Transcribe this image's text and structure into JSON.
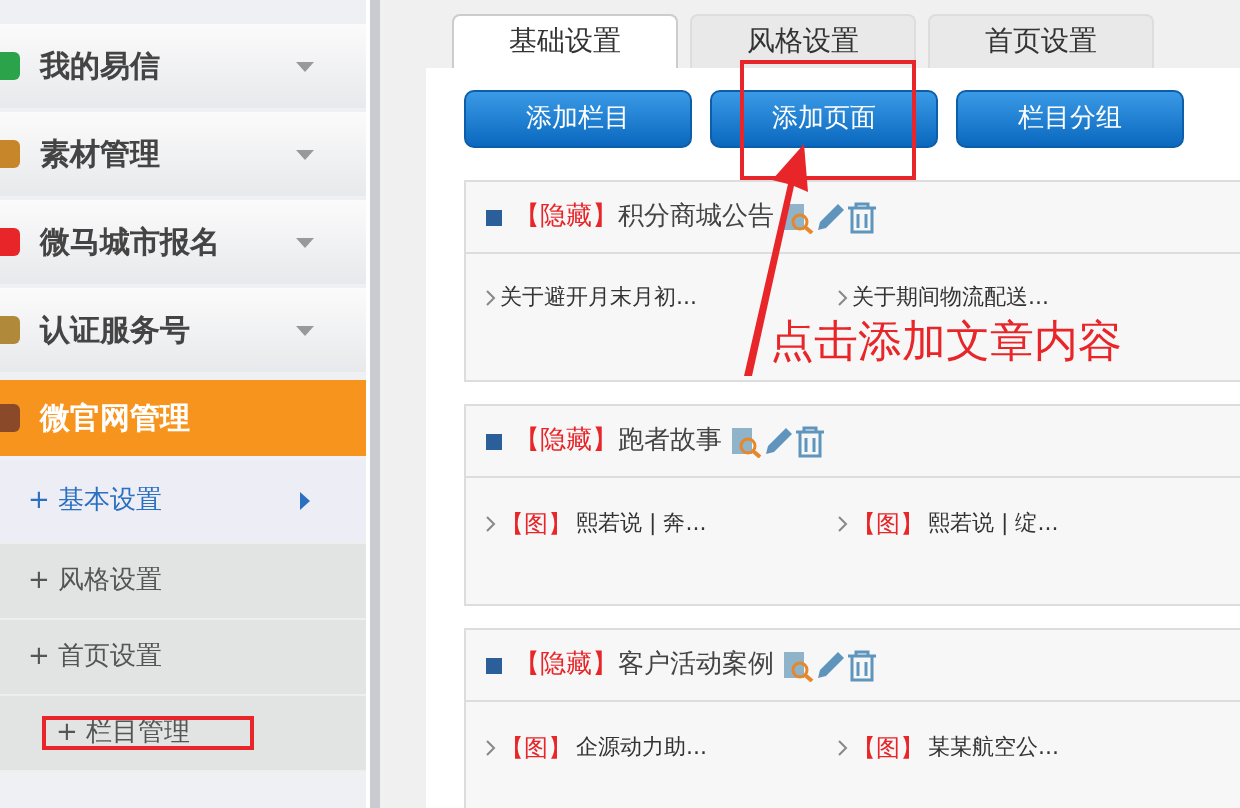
{
  "sidebar": {
    "items": [
      {
        "label": "我的易信",
        "expanded": false
      },
      {
        "label": "素材管理",
        "expanded": false
      },
      {
        "label": "微马城市报名",
        "expanded": false
      },
      {
        "label": "认证服务号",
        "expanded": false
      },
      {
        "label": "微官网管理",
        "expanded": true,
        "children": [
          {
            "label": "+ 基本设置",
            "selected": true
          },
          {
            "label": "+ 风格设置",
            "selected": false
          },
          {
            "label": "+ 首页设置",
            "selected": false
          },
          {
            "label": "+ 栏目管理",
            "selected": false,
            "highlighted": true
          }
        ]
      }
    ]
  },
  "tabs": [
    {
      "label": "基础设置",
      "selected": true
    },
    {
      "label": "风格设置",
      "selected": false
    },
    {
      "label": "首页设置",
      "selected": false
    }
  ],
  "buttons": [
    {
      "label": "添加栏目",
      "highlighted": false
    },
    {
      "label": "添加页面",
      "highlighted": true
    },
    {
      "label": "栏目分组",
      "highlighted": false
    }
  ],
  "annotation": {
    "text": "点击添加文章内容"
  },
  "panels": [
    {
      "status": "【隐藏】",
      "title": "积分商城公告",
      "items": [
        {
          "text": "关于避开月末月初..."
        },
        {
          "text": "关于期间物流配送..."
        }
      ]
    },
    {
      "status": "【隐藏】",
      "title": "跑者故事",
      "items": [
        {
          "tag": "【图】",
          "text": "熙若说 | 奔..."
        },
        {
          "tag": "【图】",
          "text": "熙若说 | 绽..."
        }
      ]
    },
    {
      "status": "【隐藏】",
      "title": "客户活动案例",
      "items": [
        {
          "tag": "【图】",
          "text": "企源动力助..."
        },
        {
          "tag": "【图】",
          "text": "某某航空公..."
        }
      ]
    }
  ]
}
